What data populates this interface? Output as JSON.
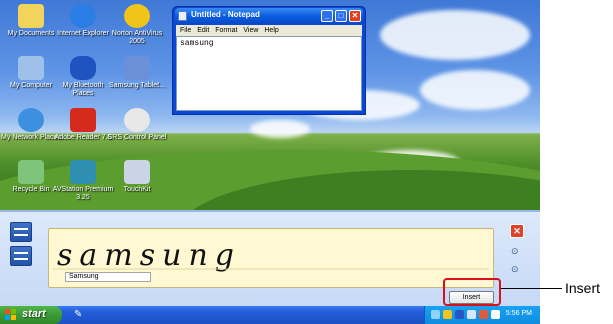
{
  "desktop": {
    "icons": [
      {
        "label": "My Documents"
      },
      {
        "label": "Internet Explorer"
      },
      {
        "label": "Norton AntiVirus 2005"
      },
      {
        "label": "My Computer"
      },
      {
        "label": "My Bluetooth Places"
      },
      {
        "label": "Samsung Tablet..."
      },
      {
        "label": "My Network Places"
      },
      {
        "label": "Adobe Reader 7.0"
      },
      {
        "label": "SRS Control Panel"
      },
      {
        "label": "Recycle Bin"
      },
      {
        "label": "AVStation Premium 3.25"
      },
      {
        "label": "TouchKit"
      }
    ]
  },
  "notepad": {
    "title": "Untitled - Notepad",
    "menu": [
      "File",
      "Edit",
      "Format",
      "View",
      "Help"
    ],
    "content": "samsung",
    "minimize_glyph": "_",
    "maximize_glyph": "□",
    "close_glyph": "✕"
  },
  "input_panel": {
    "handwriting": "samsung",
    "recognized_text": "Samsung",
    "insert_label": "Insert",
    "close_glyph": "✕"
  },
  "taskbar": {
    "start_label": "start",
    "clock": "5:56 PM"
  },
  "callout": {
    "label": "Insert"
  },
  "colors": {
    "taskbar_blue": "#245edb",
    "start_green": "#3a9a35",
    "writing_pad": "#fff8d2",
    "highlight_red": "#d8121b"
  }
}
